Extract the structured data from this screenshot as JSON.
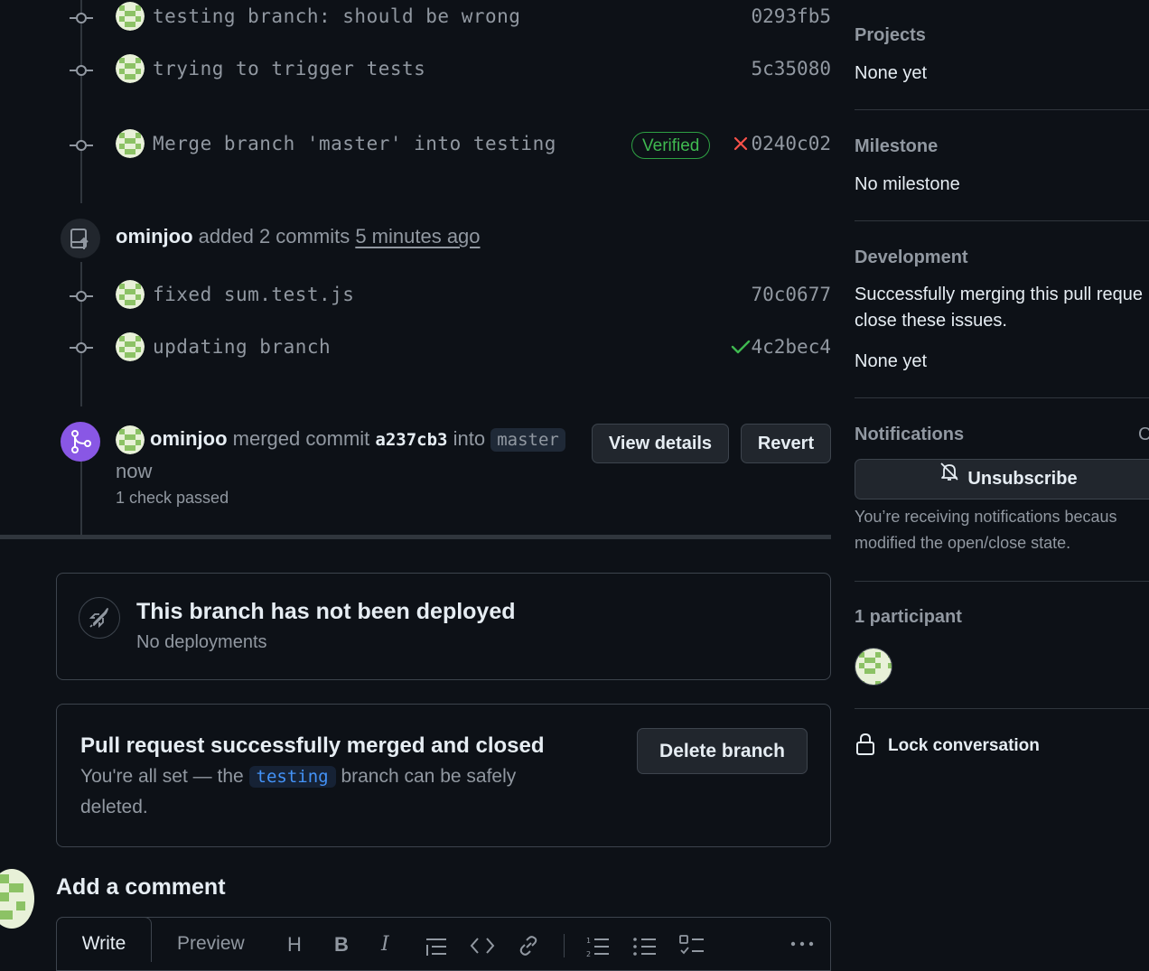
{
  "commits_top": [
    {
      "message": "testing branch: should be wrong",
      "sha": "0293fb5"
    },
    {
      "message": "trying to trigger tests",
      "sha": "5c35080"
    },
    {
      "message": "Merge branch 'master' into testing",
      "sha": "0240c02",
      "badge": "Verified",
      "status": "failed"
    }
  ],
  "event_added": {
    "user": "ominjoo",
    "action": "added 2 commits",
    "time": "5 minutes ago"
  },
  "commits_added": [
    {
      "message": "fixed sum.test.js",
      "sha": "70c0677"
    },
    {
      "message": "updating branch",
      "sha": "4c2bec4",
      "status": "success"
    }
  ],
  "event_merged": {
    "user": "ominjoo",
    "action": "merged commit",
    "commit": "a237cb3",
    "into": "into",
    "branch": "master",
    "time": "now",
    "checks": "1 check passed",
    "view_details_label": "View details",
    "revert_label": "Revert"
  },
  "deploy_card": {
    "title": "This branch has not been deployed",
    "subtitle": "No deployments"
  },
  "merged_card": {
    "title": "Pull request successfully merged and closed",
    "text_before": "You're all set — the",
    "branch": "testing",
    "text_after": "branch can be safely",
    "text_line2": "deleted.",
    "delete_label": "Delete branch"
  },
  "comment": {
    "heading": "Add a comment",
    "tab_write": "Write",
    "tab_preview": "Preview"
  },
  "sidebar": {
    "projects_label": "Projects",
    "projects_value": "None yet",
    "milestone_label": "Milestone",
    "milestone_value": "No milestone",
    "development_label": "Development",
    "development_text1": "Successfully merging this pull reque",
    "development_text2": "close these issues.",
    "development_value": "None yet",
    "notifications_label": "Notifications",
    "notifications_customize": "C",
    "unsubscribe_label": "Unsubscribe",
    "notifications_text1": "You’re receiving notifications becaus",
    "notifications_text2": "modified the open/close state.",
    "participants_label": "1 participant",
    "lock_label": "Lock conversation"
  },
  "colors": {
    "background": "#0d1117",
    "merged_purple": "#8957e5",
    "success_green": "#3fb950",
    "fail_red": "#f85149",
    "link_blue": "#4493f8"
  }
}
